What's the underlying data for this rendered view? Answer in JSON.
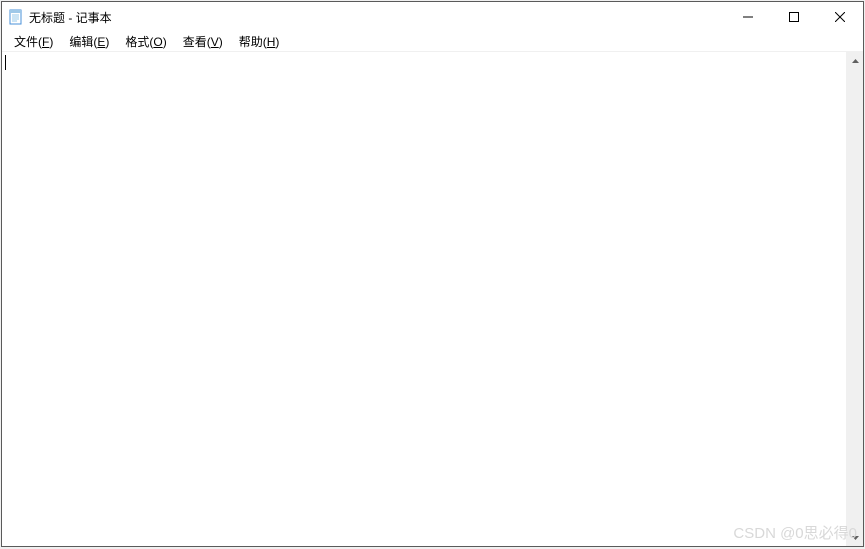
{
  "window": {
    "title": "无标题 - 记事本"
  },
  "menubar": {
    "items": [
      {
        "label": "文件(",
        "key": "F",
        "suffix": ")"
      },
      {
        "label": "编辑(",
        "key": "E",
        "suffix": ")"
      },
      {
        "label": "格式(",
        "key": "O",
        "suffix": ")"
      },
      {
        "label": "查看(",
        "key": "V",
        "suffix": ")"
      },
      {
        "label": "帮助(",
        "key": "H",
        "suffix": ")"
      }
    ]
  },
  "editor": {
    "content": ""
  },
  "watermark": "CSDN @0思必得0"
}
